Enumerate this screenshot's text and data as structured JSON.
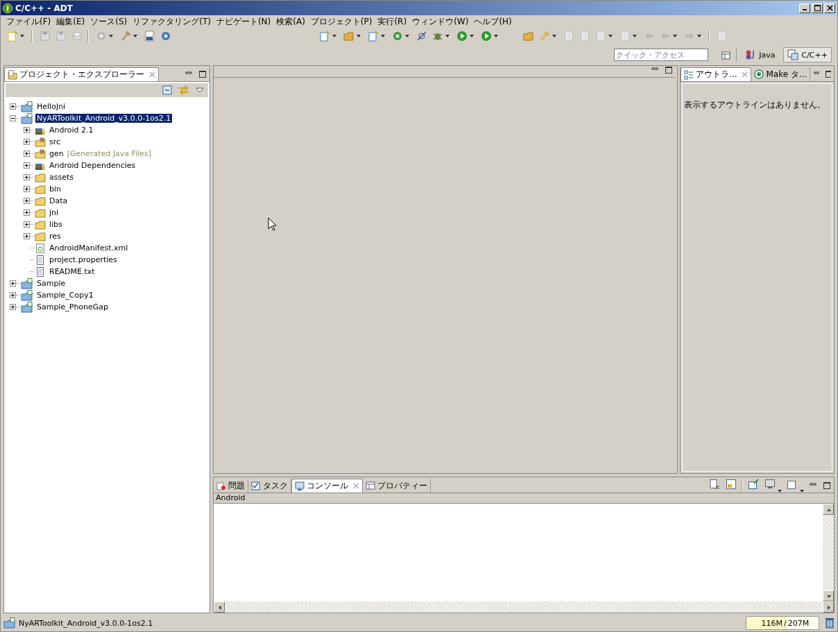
{
  "window": {
    "title": "C/C++ - ADT"
  },
  "menu": [
    "ファイル(F)",
    "編集(E)",
    "ソース(S)",
    "リファクタリング(T)",
    "ナビゲート(N)",
    "検索(A)",
    "プロジェクト(P)",
    "実行(R)",
    "ウィンドウ(W)",
    "ヘルプ(H)"
  ],
  "quick_access": {
    "placeholder": "クイック・アクセス"
  },
  "perspectives": [
    {
      "label": "Java",
      "selected": false
    },
    {
      "label": "C/C++",
      "selected": true
    }
  ],
  "explorer": {
    "tab": "プロジェクト・エクスプローラー",
    "tree": [
      {
        "label": "HelloJni",
        "kind": "project",
        "expanded": false,
        "selected": false
      },
      {
        "label": "NyARToolkit_Android_v3.0.0-1os2.1",
        "kind": "project",
        "expanded": true,
        "selected": true,
        "children": [
          {
            "label": "Android 2.1",
            "kind": "library",
            "expandable": true,
            "selected": false
          },
          {
            "label": "src",
            "kind": "package",
            "expandable": true,
            "selected": false
          },
          {
            "label": "gen",
            "decoration": "[Generated Java Files]",
            "kind": "package",
            "expandable": true,
            "selected": false
          },
          {
            "label": "Android Dependencies",
            "kind": "library",
            "expandable": true,
            "selected": false
          },
          {
            "label": "assets",
            "kind": "folder",
            "expandable": true,
            "selected": false
          },
          {
            "label": "bin",
            "kind": "folder",
            "expandable": true,
            "selected": false
          },
          {
            "label": "Data",
            "kind": "folder",
            "expandable": true,
            "selected": false
          },
          {
            "label": "jni",
            "kind": "folder",
            "expandable": true,
            "selected": false
          },
          {
            "label": "libs",
            "kind": "folder",
            "expandable": true,
            "selected": false
          },
          {
            "label": "res",
            "kind": "folder",
            "expandable": true,
            "selected": false
          },
          {
            "label": "AndroidManifest.xml",
            "kind": "manifest",
            "expandable": false,
            "selected": false
          },
          {
            "label": "project.properties",
            "kind": "file",
            "expandable": false,
            "selected": false
          },
          {
            "label": "README.txt",
            "kind": "file",
            "expandable": false,
            "selected": false
          }
        ]
      },
      {
        "label": "Sample",
        "kind": "project",
        "expanded": false,
        "selected": false
      },
      {
        "label": "Sample_Copy1",
        "kind": "project",
        "expanded": false,
        "selected": false
      },
      {
        "label": "Sample_PhoneGap",
        "kind": "project",
        "expanded": false,
        "selected": false
      }
    ]
  },
  "outline": {
    "tabs": [
      {
        "label": "アウトラ...",
        "selected": true,
        "closable": true
      },
      {
        "label": "Make タ...",
        "selected": false,
        "closable": false
      }
    ],
    "message": "表示するアウトラインはありません。"
  },
  "console": {
    "tabs": [
      {
        "label": "問題",
        "selected": false,
        "closable": false
      },
      {
        "label": "タスク",
        "selected": false,
        "closable": false
      },
      {
        "label": "コンソール",
        "selected": true,
        "closable": true
      },
      {
        "label": "プロパティー",
        "selected": false,
        "closable": false
      }
    ],
    "header": "Android"
  },
  "status_bar": {
    "text": "NyARToolkit_Android_v3.0.0-1os2.1",
    "heap": {
      "used": "116M",
      "separator": "/",
      "total": "207M",
      "level": 0.56
    }
  }
}
